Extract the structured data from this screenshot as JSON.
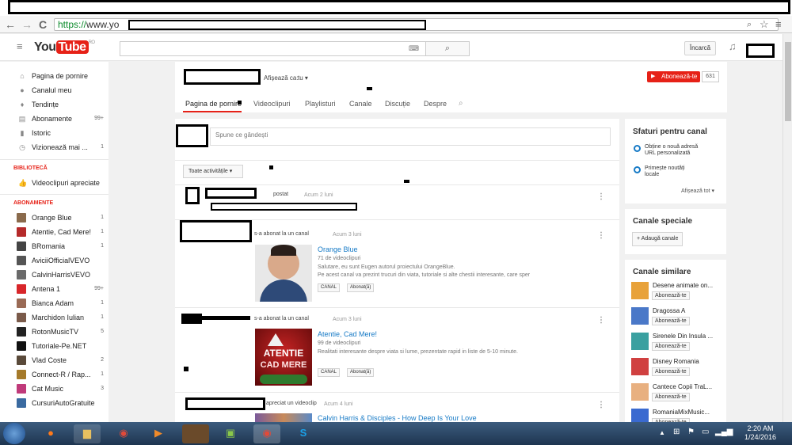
{
  "browser": {
    "url_scheme": "https://",
    "url_rest": "www.yo",
    "nav": {
      "back": "←",
      "forward": "→",
      "reload": "C"
    }
  },
  "youtube": {
    "logo_you": "You",
    "logo_tube": "Tube",
    "logo_region": "RO",
    "upload_label": "Încarcă"
  },
  "guide": {
    "main_items": [
      {
        "label": "Pagina de pornire",
        "count": ""
      },
      {
        "label": "Canalul meu",
        "count": ""
      },
      {
        "label": "Tendințe",
        "count": ""
      },
      {
        "label": "Abonamente",
        "count": "99+"
      },
      {
        "label": "Istoric",
        "count": ""
      },
      {
        "label": "Vizionează mai ...",
        "count": "1"
      }
    ],
    "library_title": "BIBLIOTECĂ",
    "library_items": [
      {
        "label": "Videoclipuri apreciate"
      }
    ],
    "subs_title": "ABONAMENTE",
    "subs": [
      {
        "label": "Orange Blue",
        "count": "1",
        "color": "#8a6a4c"
      },
      {
        "label": "Atentie, Cad Mere!",
        "count": "1",
        "color": "#b52a2a"
      },
      {
        "label": "BRomania",
        "count": "1",
        "color": "#444444"
      },
      {
        "label": "AviciiOfficialVEVO",
        "count": "",
        "color": "#555555"
      },
      {
        "label": "CalvinHarrisVEVO",
        "count": "",
        "color": "#6a6a6a"
      },
      {
        "label": "Antena 1",
        "count": "99+",
        "color": "#d8262a"
      },
      {
        "label": "Bianca Adam",
        "count": "1",
        "color": "#9a6a55"
      },
      {
        "label": "Marchidon Iulian",
        "count": "1",
        "color": "#7a5a4a"
      },
      {
        "label": "RotonMusicTV",
        "count": "5",
        "color": "#222222"
      },
      {
        "label": "Tutoriale-Pe.NET",
        "count": "",
        "color": "#111111"
      },
      {
        "label": "Vlad Coste",
        "count": "2",
        "color": "#5a4a3a"
      },
      {
        "label": "Connect-R / Rap...",
        "count": "1",
        "color": "#a57a2a"
      },
      {
        "label": "Cat Music",
        "count": "3",
        "color": "#c03a7a"
      },
      {
        "label": "CursuriAutoGratuite",
        "count": "",
        "color": "#3a6aa0"
      }
    ]
  },
  "channel": {
    "view_as_label": "Afișează ca:",
    "view_as_value": "tu",
    "subscribe_label": "Abonează-te",
    "subscribe_count": "631",
    "tabs": [
      "Pagina de pornire",
      "Videoclipuri",
      "Playlisturi",
      "Canale",
      "Discuție",
      "Despre"
    ]
  },
  "feed": {
    "post_placeholder": "Spune ce gândești",
    "filter_label": "Toate activitățile",
    "items": [
      {
        "action": "postat",
        "time": "Acum 2 luni"
      },
      {
        "action": "s-a abonat la un canal",
        "time": "Acum 3 luni",
        "title": "Orange Blue",
        "count": "71 de videoclipuri",
        "desc1": "Salutare, eu sunt Eugen autorul proiectului OrangeBlue.",
        "desc2": "Pe acest canal va prezint trucuri din viata, tutoriale si alte chestii interesante, care sper",
        "badge": "CANAL",
        "sub_state": "Abonat(ă)"
      },
      {
        "action": "s-a abonat la un canal",
        "time": "Acum 3 luni",
        "title": "Atentie, Cad Mere!",
        "count": "99 de videoclipuri",
        "desc1": "Realitati interesante despre viata si lume, prezentate rapid in liste de 5-10 minute.",
        "badge": "CANAL",
        "sub_state": "Abonat(ă)",
        "thumb_text1": "ATENTIE",
        "thumb_text2": "CAD MERE"
      },
      {
        "action": "apreciat un videoclip",
        "time": "Acum 4 luni",
        "title": "Calvin Harris & Disciples - How Deep Is Your Love"
      }
    ]
  },
  "sidebar_right": {
    "tips_title": "Sfaturi pentru canal",
    "tips": [
      "Obține o nouă adresă URL personalizată",
      "Primește noutăți locale"
    ],
    "show_all": "Afișează tot",
    "featured_title": "Canale speciale",
    "add_channels": "+ Adaugă canale",
    "similar_title": "Canale similare",
    "similar": [
      {
        "name": "Desene animate on...",
        "color": "#e8a23a"
      },
      {
        "name": "Dragossa A",
        "color": "#4a78c8"
      },
      {
        "name": "Sirenele Din Insula ...",
        "color": "#3aa0a0"
      },
      {
        "name": "Disney Romania",
        "color": "#d04040"
      },
      {
        "name": "Cantece Copii TraL...",
        "color": "#e8b080"
      },
      {
        "name": "RomaniaMixMusic...",
        "color": "#3a6ad0"
      }
    ],
    "subscribe_label": "Abonează-te"
  },
  "taskbar": {
    "time": "2:20 AM",
    "date": "1/24/2016"
  }
}
